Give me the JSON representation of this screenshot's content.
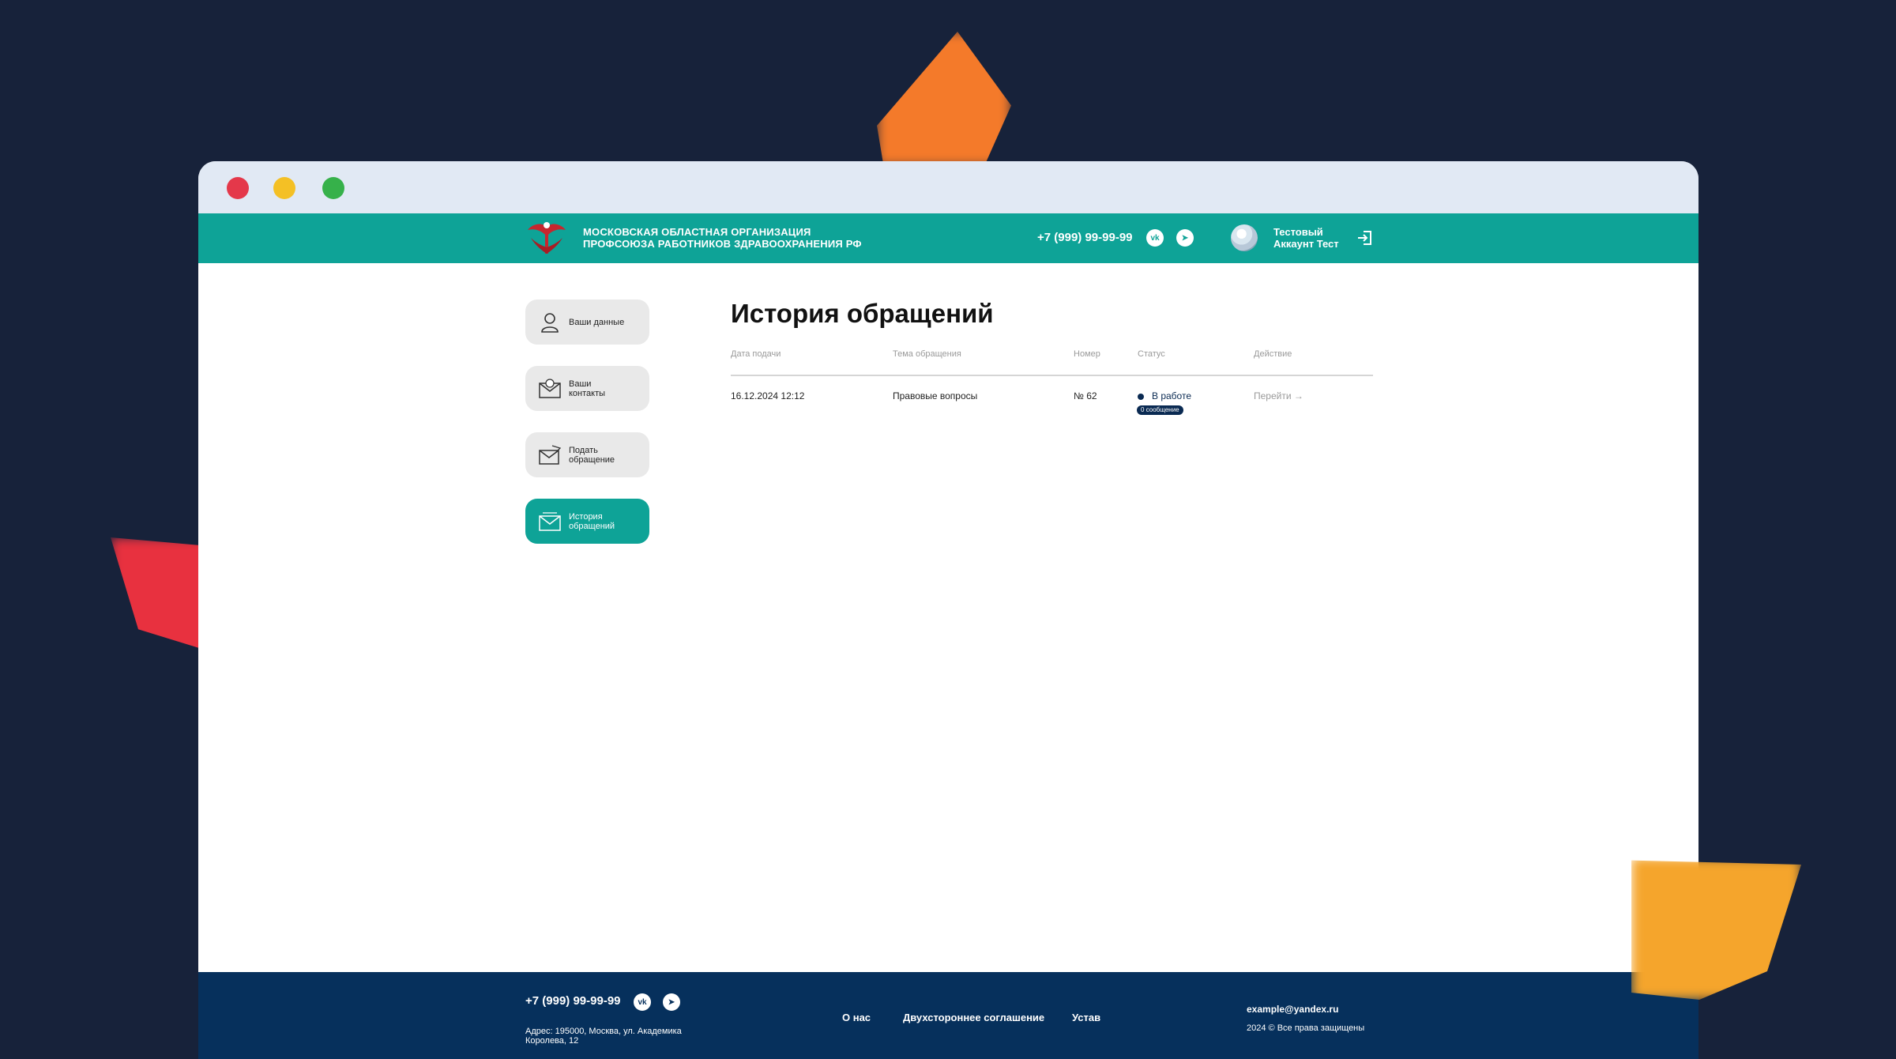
{
  "header": {
    "org_name_line1": "МОСКОВСКАЯ ОБЛАСТНАЯ ОРГАНИЗАЦИЯ",
    "org_name_line2": "ПРОФСОЮЗА РАБОТНИКОВ ЗДРАВООХРАНЕНИЯ РФ",
    "phone": "+7 (999) 99-99-99",
    "vk_icon_glyph": "vk",
    "tg_icon_glyph": "➤",
    "user_line1": "Тестовый",
    "user_line2": "Аккаунт Тест"
  },
  "sidebar": {
    "items": [
      {
        "label": "Ваши данные",
        "icon": "user-icon",
        "active": false
      },
      {
        "label": "Ваши\nконтакты",
        "icon": "contacts-envelope-icon",
        "active": false
      },
      {
        "label": "Подать\nобращение",
        "icon": "send-envelope-icon",
        "active": false
      },
      {
        "label": "История\nобращений",
        "icon": "history-envelope-icon",
        "active": true
      }
    ]
  },
  "main": {
    "title": "История обращений",
    "columns": [
      "Дата подачи",
      "Тема обращения",
      "Номер",
      "Статус",
      "Действие"
    ],
    "rows": [
      {
        "date": "16.12.2024 12:12",
        "topic": "Правовые вопросы",
        "number": "№ 62",
        "status": "В работе",
        "badge": "0 сообщение",
        "action": "Перейти →"
      }
    ]
  },
  "footer": {
    "phone": "+7 (999) 99-99-99",
    "vk_icon_glyph": "vk",
    "tg_icon_glyph": "➤",
    "address_line1": "Адрес: 195000, Москва, ул. Академика",
    "address_line2": "Королева, 12",
    "links": [
      "О нас",
      "Двухстороннее соглашение",
      "Устав"
    ],
    "email": "example@yandex.ru",
    "copyright": "2024 © Все права защищены"
  },
  "colors": {
    "accent": "#0ea397",
    "footer_bg": "#06305c",
    "page_bg": "#17223a",
    "status": "#0a2a52"
  }
}
